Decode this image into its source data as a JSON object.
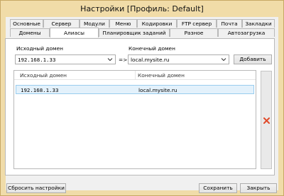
{
  "window": {
    "title": "Настройки [Профиль: Default]"
  },
  "tabs_row1": [
    "Основные",
    "Сервер",
    "Модули",
    "Меню",
    "Кодировки",
    "FTP сервер",
    "Почта",
    "Закладки"
  ],
  "tabs_row2": [
    "Домены",
    "Алиасы",
    "Планировщик заданий",
    "Разное",
    "Автозагрузка"
  ],
  "active_tab": "Алиасы",
  "form": {
    "source_label": "Исходный домен",
    "source_value": "192.168.1.33",
    "arrow": "=>",
    "target_label": "Конечный домен",
    "target_value": "local.mysite.ru",
    "add_button": "Добавить"
  },
  "table": {
    "columns": [
      "Исходный домен",
      "Конечный домен"
    ],
    "rows": [
      {
        "source": "192.168.1.33",
        "target": "local.mysite.ru"
      }
    ]
  },
  "sidebar": {
    "delete_icon": "red-x-icon",
    "delete_color": "#e04b2b"
  },
  "footer": {
    "reset_button": "Сбросить настройки",
    "save_button": "Сохранить",
    "close_button": "Закрыть"
  }
}
